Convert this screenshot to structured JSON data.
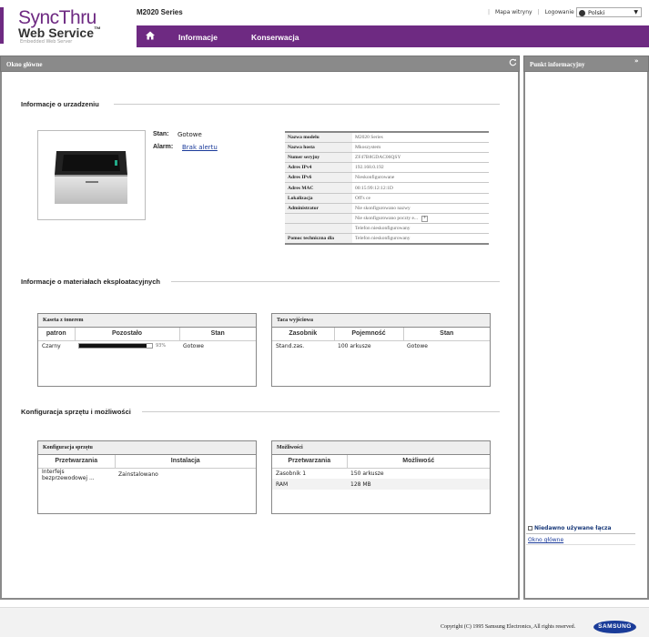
{
  "header": {
    "logo_sync": "SyncThru",
    "logo_web": "Web Service",
    "logo_tm": "™",
    "logo_subtitle": "Embedded Web Server",
    "model": "M2020 Series",
    "site_map": "Mapa witryny",
    "login": "Logowanie",
    "separator": "|",
    "language": "Polski"
  },
  "nav": {
    "home_icon": "home-icon",
    "info": "Informacje",
    "maintenance": "Konserwacja"
  },
  "main": {
    "title": "Okno główne",
    "device_section": "Informacje o urzadzeniu",
    "status_label": "Stan:",
    "status_value": "Gotowe",
    "alarm_label": "Alarm:",
    "alarm_value": "Brak alertu",
    "device_info": [
      {
        "key": "Nazwa modelu",
        "value": "M2020 Series"
      },
      {
        "key": "Nazwa hosta",
        "value": "Mkoszystem"
      },
      {
        "key": "Numer seryjny",
        "value": "ZF47B8GDAC06QSY"
      },
      {
        "key": "Adres IPv4",
        "value": "192.168.0.192"
      },
      {
        "key": "Adres IPv6",
        "value": "Nieskonfigurowane"
      },
      {
        "key": "Adres MAC",
        "value": "00:15:99:12:12:1D"
      },
      {
        "key": "Lokalizacja",
        "value": "Off's ce"
      },
      {
        "key": "Administrator",
        "value": "Nie skonfigurowano nazwy"
      },
      {
        "key": "",
        "value": "Nie skonfigurowano poczty e..."
      },
      {
        "key": "",
        "value": "Telefon nieskonfigurowany"
      },
      {
        "key": "Pomoc techniczna dla",
        "value": "Telefon nieskonfigurowany"
      }
    ],
    "supplies_section": "Informacje o materiałach eksploatacyjnych",
    "toner": {
      "title": "Kaseta z tonerem",
      "headers": [
        "patron",
        "Pozostało",
        "Stan"
      ],
      "rows": [
        {
          "name": "Czarny",
          "percent_text": "93%",
          "percent": 93,
          "state": "Gotowe"
        }
      ]
    },
    "output_tray": {
      "title": "Taca wyjściowa",
      "headers": [
        "Zasobnik",
        "Pojemność",
        "Stan"
      ],
      "rows": [
        {
          "tray": "Stand.zas.",
          "capacity": "100 arkusze",
          "state": "Gotowe"
        }
      ]
    },
    "config_section": "Konfiguracja sprzętu i możliwości",
    "hw_config": {
      "title": "Konfiguracja sprzętu",
      "headers": [
        "Przetwarzania",
        "Instalacja"
      ],
      "rows": [
        {
          "item": "Interfejs bezprzewodowej ...",
          "value": "Zainstalowano"
        }
      ]
    },
    "capabilities": {
      "title": "Możliwości",
      "headers": [
        "Przetwarzania",
        "Możliwość"
      ],
      "rows": [
        {
          "item": "Zasobnik 1",
          "value": "150 arkusze"
        },
        {
          "item": "RAM",
          "value": "128 MB"
        }
      ]
    }
  },
  "side": {
    "title": "Punkt informacyjny",
    "expand_icon": "»",
    "recent_title": "Niedawno używane łącza",
    "recent_link": "Okno główne"
  },
  "footer": {
    "copyright": "Copyright (C) 1995 Samsung Electronics, All rights reserved.",
    "brand": "SAMSUNG"
  }
}
